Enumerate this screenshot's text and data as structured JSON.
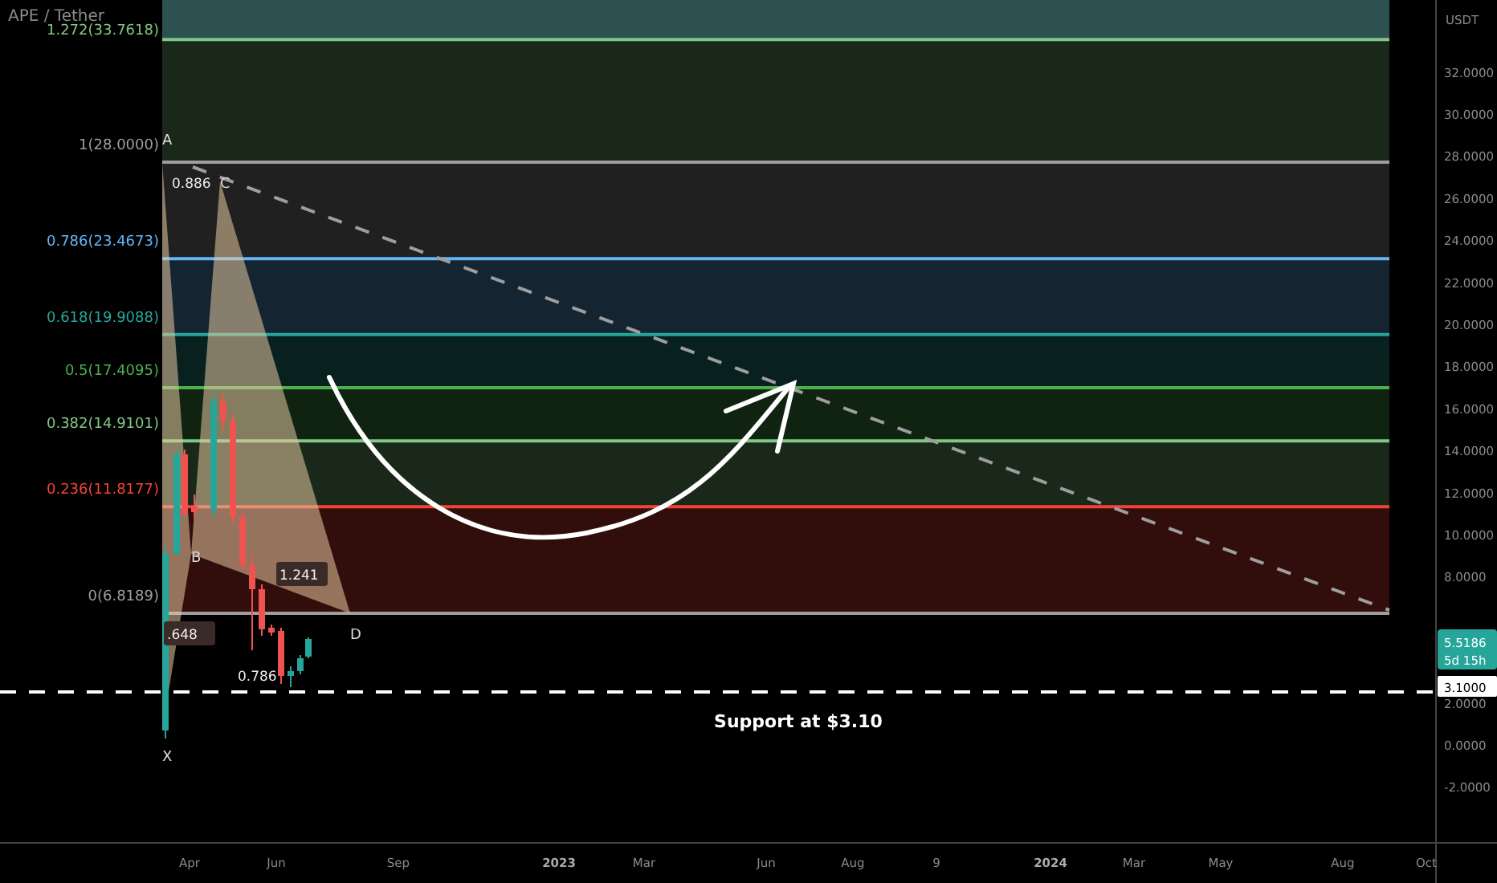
{
  "symbol": "APE / Tether",
  "fib_levels": [
    {
      "label": "1.272(33.7618)",
      "color": "#81c784"
    },
    {
      "label": "1(28.0000)",
      "color": "#9e9e9e"
    },
    {
      "label": "0.786(23.4673)",
      "color": "#64b5f6"
    },
    {
      "label": "0.618(19.9088)",
      "color": "#26a69a"
    },
    {
      "label": "0.5(17.4095)",
      "color": "#4caf50"
    },
    {
      "label": "0.382(14.9101)",
      "color": "#81c784"
    },
    {
      "label": "0.236(11.8177)",
      "color": "#f44336"
    },
    {
      "label": "0(6.8189)",
      "color": "#9e9e9e"
    }
  ],
  "pattern_points": [
    "X",
    "A",
    "B",
    "C",
    "D"
  ],
  "pattern_ratios": [
    "0.886",
    "1.241",
    ".648",
    "0.786"
  ],
  "support_label": "Support at $3.10",
  "price_axis": {
    "unit": "USDT",
    "labels": [
      "32.0000",
      "30.0000",
      "28.0000",
      "26.0000",
      "24.0000",
      "22.0000",
      "20.0000",
      "18.0000",
      "16.0000",
      "14.0000",
      "12.0000",
      "10.0000",
      "8.0000",
      "2.0000",
      "0.0000",
      "-2.0000"
    ]
  },
  "last_price": {
    "price": "5.5186",
    "countdown": "5d 15h"
  },
  "support_price": "3.1000",
  "time_axis": [
    {
      "label": "Apr",
      "bold": false
    },
    {
      "label": "Jun",
      "bold": false
    },
    {
      "label": "Sep",
      "bold": false
    },
    {
      "label": "2023",
      "bold": true
    },
    {
      "label": "Mar",
      "bold": false
    },
    {
      "label": "Jun",
      "bold": false
    },
    {
      "label": "Aug",
      "bold": false
    },
    {
      "label": "9",
      "bold": false
    },
    {
      "label": "2024",
      "bold": true
    },
    {
      "label": "Mar",
      "bold": false
    },
    {
      "label": "May",
      "bold": false
    },
    {
      "label": "Aug",
      "bold": false
    },
    {
      "label": "Oct",
      "bold": false
    }
  ]
}
